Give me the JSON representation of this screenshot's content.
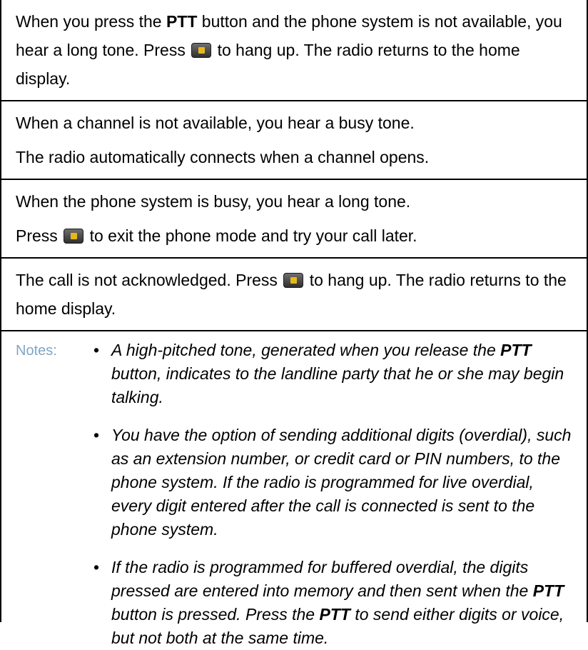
{
  "rows": [
    {
      "p1": {
        "a": "When you press the ",
        "b": "PTT",
        "c": " button and the phone system is not available, you hear a long tone. Press ",
        "icon": "home-key-icon",
        "d": " to hang up. The radio returns to the home display."
      }
    },
    {
      "p1": "When a channel is not available, you hear a busy tone.",
      "p2": "The radio automatically connects when a channel opens."
    },
    {
      "p1": "When the phone system is busy, you hear a long tone.",
      "p2": {
        "a": "Press ",
        "icon": "home-key-icon",
        "b": " to exit the phone mode and try your call later."
      }
    },
    {
      "p1": {
        "a": "The call is not acknowledged. Press ",
        "icon": "home-key-icon",
        "b": " to hang up. The radio returns to the home display."
      }
    }
  ],
  "notes": {
    "label": "Notes:",
    "bullet": "•",
    "items": [
      {
        "a": "A high-pitched tone, generated when you release the ",
        "b": "PTT",
        "c": " button, indicates to the landline party that he or she may begin talking."
      },
      {
        "a": "You have the option of sending additional digits (overdial), such as an extension number, or credit card or PIN numbers, to the phone system. If the radio is programmed for live overdial, every digit entered after the call is connected is sent to the phone system."
      },
      {
        "a": "If the radio is programmed for buffered overdial, the digits pressed are entered into memory and then sent when the ",
        "b": "PTT",
        "c": " button is pressed. Press the ",
        "d": "PTT",
        "e": " to send either digits or voice, but not both at the same time."
      }
    ]
  },
  "colors": {
    "border": "#000000",
    "notes_label": "#7fa6c4",
    "icon_body": "#3f3f3f",
    "icon_symbol": "#e6b81e"
  }
}
